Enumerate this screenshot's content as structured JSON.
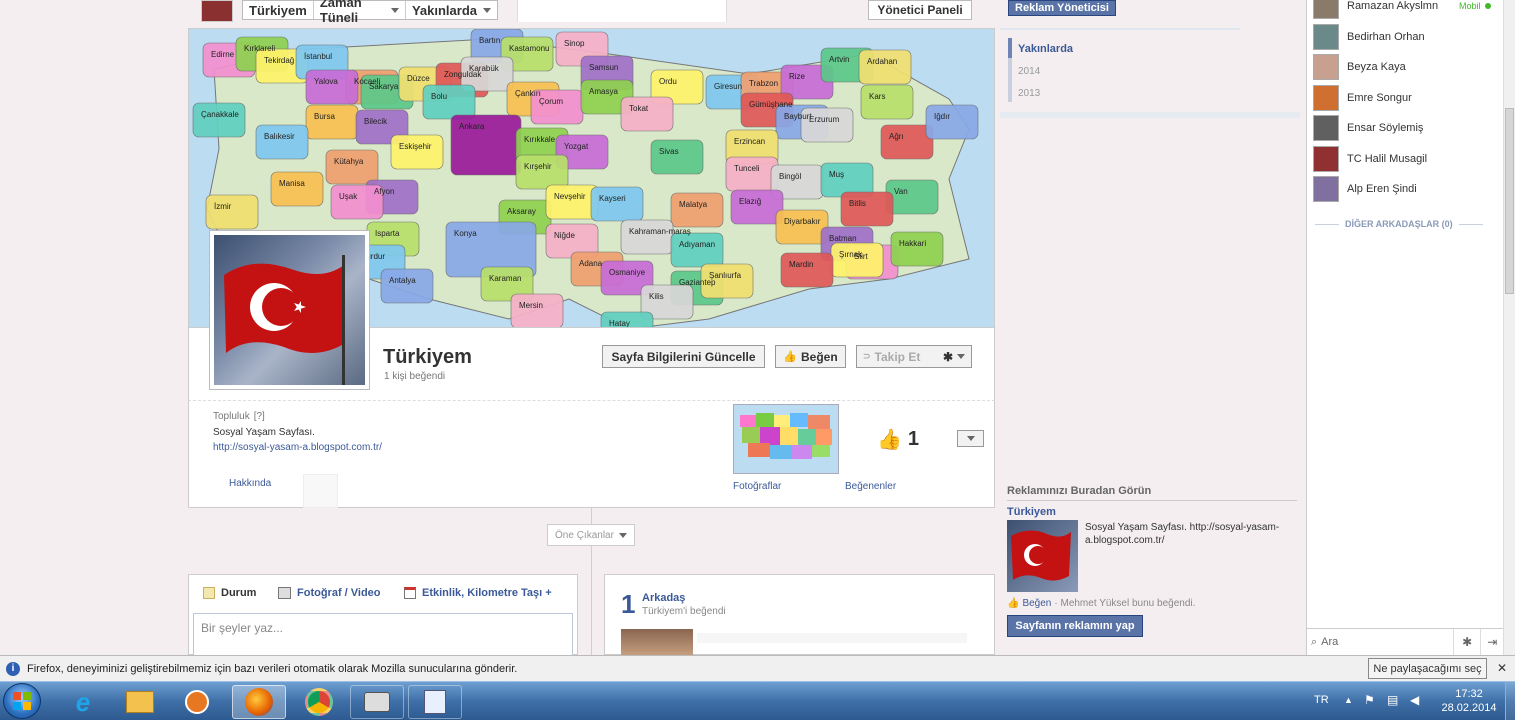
{
  "nav": {
    "page_name": "Türkiyem",
    "timeline": "Zaman Tüneli",
    "recent": "Yakınlarda",
    "admin_panel": "Yönetici Paneli",
    "ad_manager": "Reklam Yöneticisi"
  },
  "cover": {
    "provinces": [
      {
        "name": "Edirne"
      },
      {
        "name": "Kırklareli"
      },
      {
        "name": "Tekirdağ"
      },
      {
        "name": "İstanbul"
      },
      {
        "name": "Kocaeli"
      },
      {
        "name": "Yalova"
      },
      {
        "name": "Sakarya"
      },
      {
        "name": "Düzce"
      },
      {
        "name": "Zonguldak"
      },
      {
        "name": "Bartın"
      },
      {
        "name": "Kastamonu"
      },
      {
        "name": "Sinop"
      },
      {
        "name": "Karabük"
      },
      {
        "name": "Bolu"
      },
      {
        "name": "Çankırı"
      },
      {
        "name": "Samsun"
      },
      {
        "name": "Çorum"
      },
      {
        "name": "Amasya"
      },
      {
        "name": "Ordu"
      },
      {
        "name": "Giresun"
      },
      {
        "name": "Trabzon"
      },
      {
        "name": "Rize"
      },
      {
        "name": "Artvin"
      },
      {
        "name": "Ardahan"
      },
      {
        "name": "Gümüşhane"
      },
      {
        "name": "Bayburt"
      },
      {
        "name": "Kars"
      },
      {
        "name": "Tokat"
      },
      {
        "name": "Erzurum"
      },
      {
        "name": "Çanakkale"
      },
      {
        "name": "Bursa"
      },
      {
        "name": "Bilecik"
      },
      {
        "name": "Ankara"
      },
      {
        "name": "Kırıkkale"
      },
      {
        "name": "Eskişehir"
      },
      {
        "name": "Balıkesir"
      },
      {
        "name": "Kütahya"
      },
      {
        "name": "Yozgat"
      },
      {
        "name": "Sivas"
      },
      {
        "name": "Erzincan"
      },
      {
        "name": "Ağrı"
      },
      {
        "name": "Iğdır"
      },
      {
        "name": "Kırşehir"
      },
      {
        "name": "Tunceli"
      },
      {
        "name": "Bingöl"
      },
      {
        "name": "Muş"
      },
      {
        "name": "Manisa"
      },
      {
        "name": "Afyon"
      },
      {
        "name": "Uşak"
      },
      {
        "name": "Aksaray"
      },
      {
        "name": "Nevşehir"
      },
      {
        "name": "Kayseri"
      },
      {
        "name": "Malatya"
      },
      {
        "name": "Elazığ"
      },
      {
        "name": "Van"
      },
      {
        "name": "İzmir"
      },
      {
        "name": "Bitlis"
      },
      {
        "name": "Konya"
      },
      {
        "name": "Isparta"
      },
      {
        "name": "Niğde"
      },
      {
        "name": "Kahraman-maraş"
      },
      {
        "name": "Adıyaman"
      },
      {
        "name": "Diyarbakır"
      },
      {
        "name": "Batman"
      },
      {
        "name": "Siirt"
      },
      {
        "name": "Hakkari"
      },
      {
        "name": "Şırnak"
      },
      {
        "name": "Burdur"
      },
      {
        "name": "Adana"
      },
      {
        "name": "Osmaniye"
      },
      {
        "name": "Gaziantep"
      },
      {
        "name": "Şanlıurfa"
      },
      {
        "name": "Mardin"
      },
      {
        "name": "Antalya"
      },
      {
        "name": "Karaman"
      },
      {
        "name": "Mersin"
      },
      {
        "name": "Kilis"
      },
      {
        "name": "Hatay"
      }
    ]
  },
  "header": {
    "title": "Türkiyem",
    "likes_text": "1 kişi beğendi",
    "update_button": "Sayfa Bilgilerini Güncelle",
    "like_button": "Beğen",
    "follow_button": "Takip Et"
  },
  "info": {
    "category": "Topluluk",
    "help": "[?]",
    "description": "Sosyal Yaşam Sayfası.",
    "url": "http://sosyal-yasam-a.blogspot.com.tr/",
    "about_tab": "Hakkında",
    "photos_tab": "Fotoğraflar",
    "likes_tab": "Beğenenler",
    "like_count": "1"
  },
  "highlights": "Öne Çıkanlar",
  "composer": {
    "status": "Durum",
    "photo": "Fotoğraf / Video",
    "event": "Etkinlik, Kilometre Taşı +",
    "placeholder": "Bir şeyler yaz..."
  },
  "friends": {
    "count": "1",
    "label": "Arkadaş",
    "sub": "Türkiyem'i beğendi"
  },
  "timeline_years": {
    "recent": "Yakınlarda",
    "y2014": "2014",
    "y2013": "2013"
  },
  "ad": {
    "heading": "Reklamınızı Buradan Görün",
    "page_name": "Türkiyem",
    "text": "Sosyal Yaşam Sayfası. http://sosyal-yasam-a.blogspot.com.tr/",
    "like": "Beğen",
    "liked_by": "· Mehmet Yüksel bunu beğendi.",
    "promote_button": "Sayfanın reklamını yap"
  },
  "chat": {
    "friends": [
      {
        "name": "Ramazan Akyslmn",
        "status": "Mobil",
        "color": "#8a7a6a"
      },
      {
        "name": "Bedirhan Orhan",
        "status": "",
        "color": "#6a8a8a"
      },
      {
        "name": "Beyza Kaya",
        "status": "",
        "color": "#c8a090"
      },
      {
        "name": "Emre Songur",
        "status": "",
        "color": "#d07030"
      },
      {
        "name": "Ensar Söylemiş",
        "status": "",
        "color": "#606060"
      },
      {
        "name": "TC Halil Musagil",
        "status": "",
        "color": "#903030"
      },
      {
        "name": "Alp Eren Şindi",
        "status": "",
        "color": "#8070a0"
      }
    ],
    "other_friends": "DİĞER ARKADAŞLAR (0)",
    "search_placeholder": "Ara",
    "online_color": "#42b72a"
  },
  "notice": {
    "text": "Firefox, deneyiminizi geliştirebilmemiz için bazı verileri otomatik olarak Mozilla sunucularına gönderir.",
    "button": "Ne paylaşacağımı seç"
  },
  "taskbar": {
    "lang": "TR",
    "time": "17:32",
    "date": "28.02.2014"
  },
  "colors": {
    "fb_blue": "#3b5998",
    "button_blue": "#5b74a8"
  }
}
